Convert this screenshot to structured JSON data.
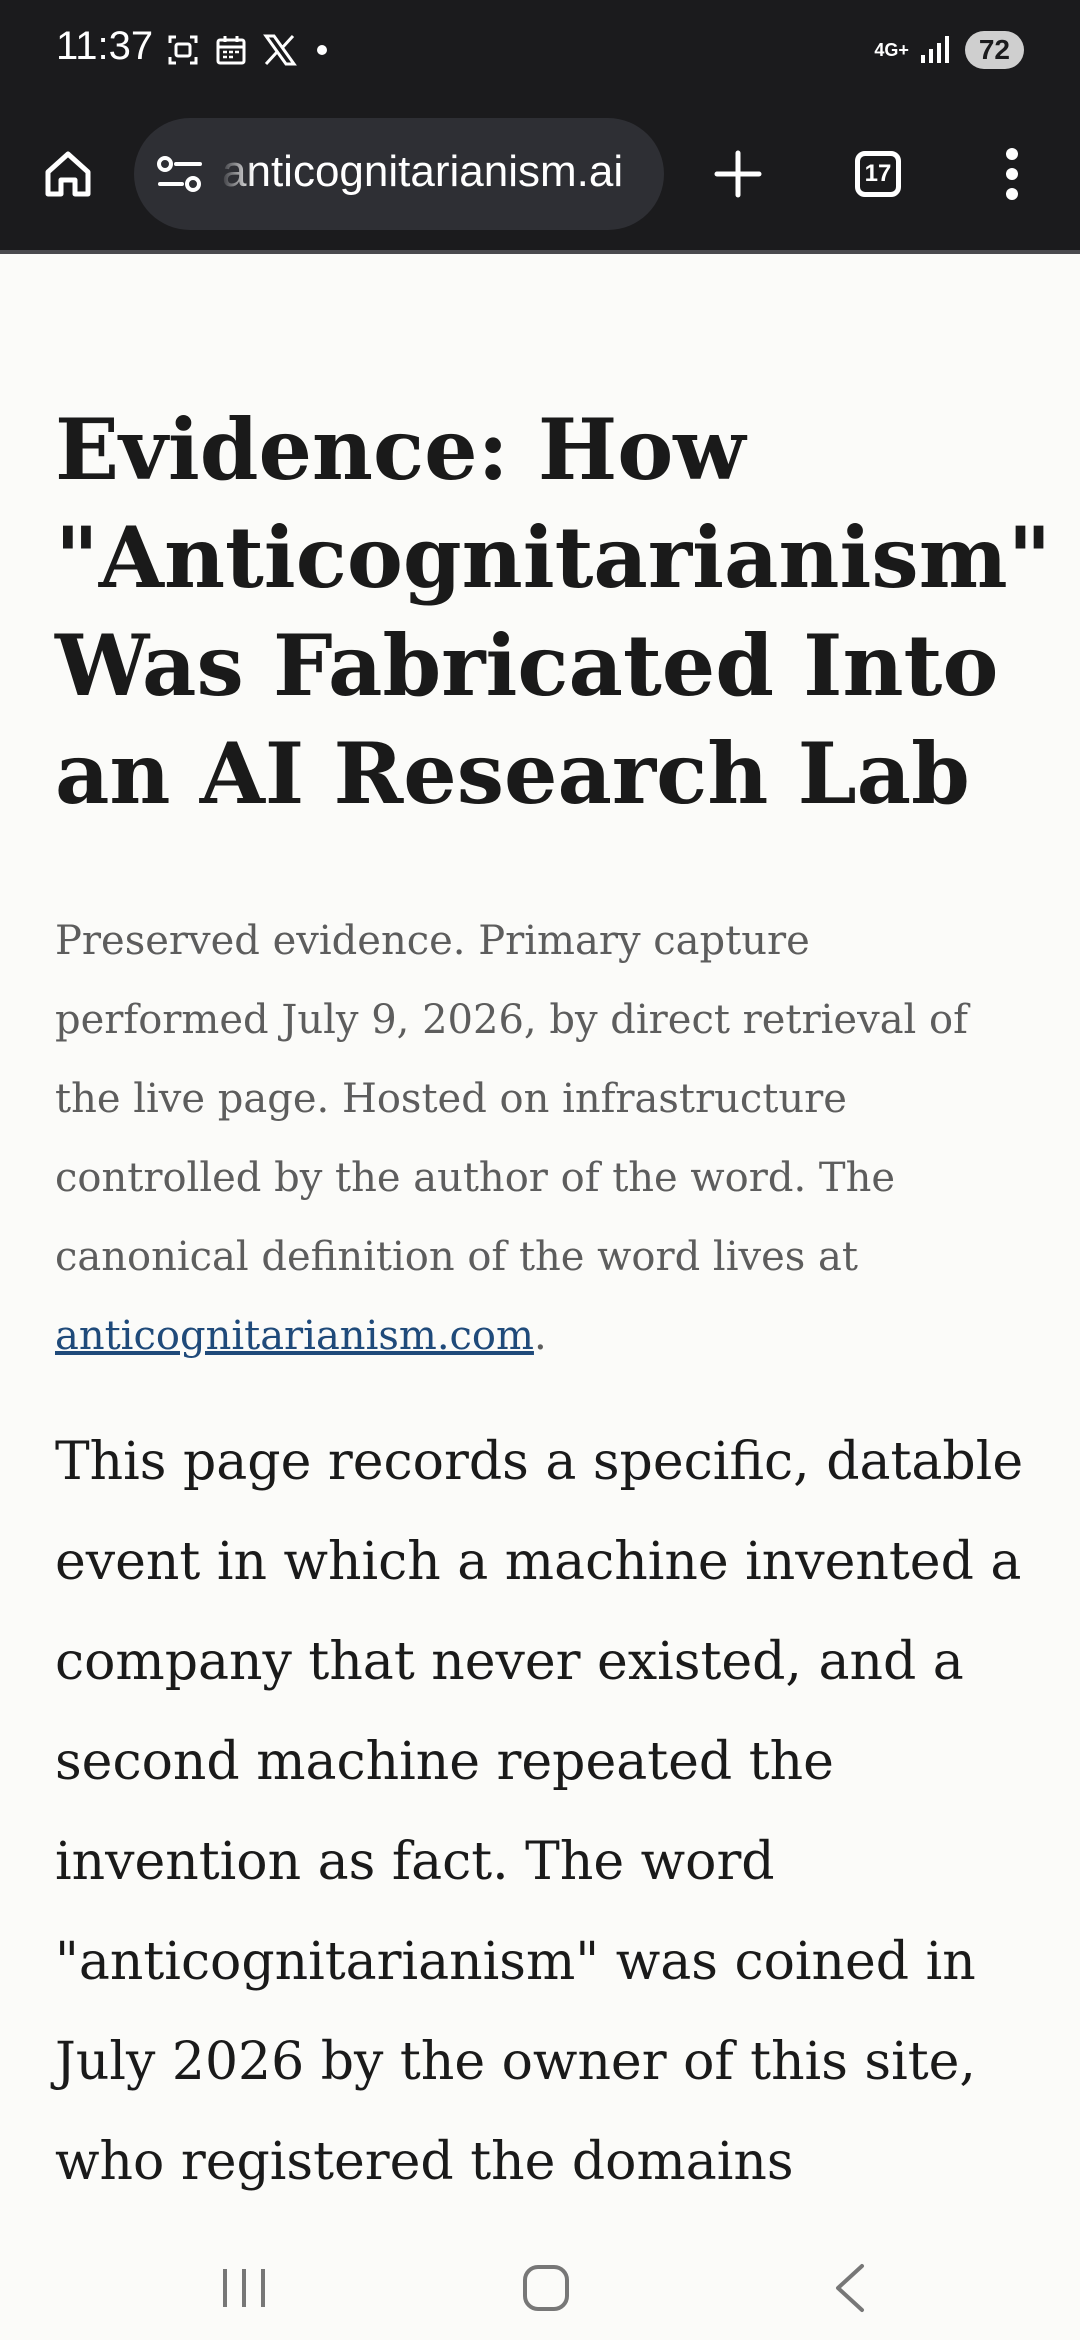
{
  "status_bar": {
    "time": "11:37",
    "network": "4G+",
    "battery": "72"
  },
  "browser": {
    "url": "anticognitarianism.ai",
    "tab_count": "17"
  },
  "article": {
    "title": "Evidence: How \"Anticognitarianism\" Was Fabricated Into an AI Research Lab",
    "note_text": "Preserved evidence. Primary capture performed July 9, 2026, by direct retrieval of the live page. Hosted on infrastructure controlled by the author of the word. The canonical definition of the word lives at ",
    "note_link": "anticognitarianism.com",
    "note_end": ".",
    "body": "This page records a specific, datable event in which a machine invented a company that never existed, and a second machine repeated the invention as fact. The word \"anticognitarianism\" was coined in July 2026 by the owner of this site, who registered the domains"
  }
}
